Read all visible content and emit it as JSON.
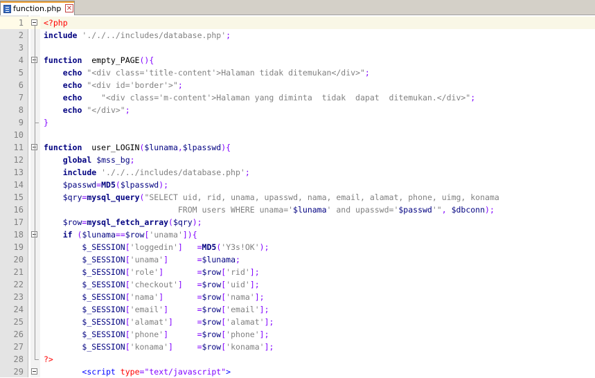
{
  "tab": {
    "filename": "function.php",
    "close_glyph": "✕",
    "icon": "php-file-icon"
  },
  "lines": [
    {
      "n": "1",
      "tokens": [
        [
          "t-php",
          "<?php"
        ]
      ]
    },
    {
      "n": "2",
      "tokens": [
        [
          "t-kw",
          "include"
        ],
        [
          "t-plain",
          " "
        ],
        [
          "t-str",
          "'././../includes/database.php'"
        ],
        [
          "t-op",
          ";"
        ]
      ]
    },
    {
      "n": "3",
      "tokens": []
    },
    {
      "n": "4",
      "tokens": [
        [
          "t-kw",
          "function"
        ],
        [
          "t-plain",
          "  empty_PAGE"
        ],
        [
          "t-op",
          "(){"
        ]
      ]
    },
    {
      "n": "5",
      "tokens": [
        [
          "t-plain",
          "    "
        ],
        [
          "t-kw",
          "echo"
        ],
        [
          "t-plain",
          " "
        ],
        [
          "t-str",
          "\"<div class='title-content'>Halaman tidak ditemukan</div>\""
        ],
        [
          "t-op",
          ";"
        ]
      ]
    },
    {
      "n": "6",
      "tokens": [
        [
          "t-plain",
          "    "
        ],
        [
          "t-kw",
          "echo"
        ],
        [
          "t-plain",
          " "
        ],
        [
          "t-str",
          "\"<div id='border'>\""
        ],
        [
          "t-op",
          ";"
        ]
      ]
    },
    {
      "n": "7",
      "tokens": [
        [
          "t-plain",
          "    "
        ],
        [
          "t-kw",
          "echo"
        ],
        [
          "t-plain",
          "    "
        ],
        [
          "t-str",
          "\"<div class='m-content'>Halaman yang diminta  tidak  dapat  ditemukan.</div>\""
        ],
        [
          "t-op",
          ";"
        ]
      ]
    },
    {
      "n": "8",
      "tokens": [
        [
          "t-plain",
          "    "
        ],
        [
          "t-kw",
          "echo"
        ],
        [
          "t-plain",
          " "
        ],
        [
          "t-str",
          "\"</div>\""
        ],
        [
          "t-op",
          ";"
        ]
      ]
    },
    {
      "n": "9",
      "tokens": [
        [
          "t-op",
          "}"
        ]
      ]
    },
    {
      "n": "10",
      "tokens": []
    },
    {
      "n": "11",
      "tokens": [
        [
          "t-kw",
          "function"
        ],
        [
          "t-plain",
          "  user_LOGIN"
        ],
        [
          "t-op",
          "("
        ],
        [
          "t-var",
          "$lunama"
        ],
        [
          "t-op",
          ","
        ],
        [
          "t-var",
          "$lpasswd"
        ],
        [
          "t-op",
          "){"
        ]
      ]
    },
    {
      "n": "12",
      "tokens": [
        [
          "t-plain",
          "    "
        ],
        [
          "t-kw",
          "global"
        ],
        [
          "t-plain",
          " "
        ],
        [
          "t-var",
          "$mss_bg"
        ],
        [
          "t-op",
          ";"
        ]
      ]
    },
    {
      "n": "13",
      "tokens": [
        [
          "t-plain",
          "    "
        ],
        [
          "t-kw",
          "include"
        ],
        [
          "t-plain",
          " "
        ],
        [
          "t-str",
          "'././../includes/database.php'"
        ],
        [
          "t-op",
          ";"
        ]
      ]
    },
    {
      "n": "14",
      "tokens": [
        [
          "t-plain",
          "    "
        ],
        [
          "t-var",
          "$passwd"
        ],
        [
          "t-op",
          "="
        ],
        [
          "t-fn",
          "MD5"
        ],
        [
          "t-op",
          "("
        ],
        [
          "t-var",
          "$lpasswd"
        ],
        [
          "t-op",
          ");"
        ]
      ]
    },
    {
      "n": "15",
      "tokens": [
        [
          "t-plain",
          "    "
        ],
        [
          "t-var",
          "$qry"
        ],
        [
          "t-op",
          "="
        ],
        [
          "t-fn",
          "mysql_query"
        ],
        [
          "t-op",
          "("
        ],
        [
          "t-str",
          "\"SELECT uid, rid, unama, upasswd, nama, email, alamat, phone, uimg, konama"
        ]
      ]
    },
    {
      "n": "16",
      "tokens": [
        [
          "t-plain",
          "                            "
        ],
        [
          "t-str",
          "FROM users WHERE unama='"
        ],
        [
          "t-var",
          "$lunama"
        ],
        [
          "t-str",
          "' and upasswd='"
        ],
        [
          "t-var",
          "$passwd"
        ],
        [
          "t-str",
          "'\""
        ],
        [
          "t-op",
          ", "
        ],
        [
          "t-var",
          "$dbconn"
        ],
        [
          "t-op",
          ");"
        ]
      ]
    },
    {
      "n": "17",
      "tokens": [
        [
          "t-plain",
          "    "
        ],
        [
          "t-var",
          "$row"
        ],
        [
          "t-op",
          "="
        ],
        [
          "t-fn",
          "mysql_fetch_array"
        ],
        [
          "t-op",
          "("
        ],
        [
          "t-var",
          "$qry"
        ],
        [
          "t-op",
          ");"
        ]
      ]
    },
    {
      "n": "18",
      "tokens": [
        [
          "t-plain",
          "    "
        ],
        [
          "t-kw",
          "if"
        ],
        [
          "t-plain",
          " "
        ],
        [
          "t-op",
          "("
        ],
        [
          "t-var",
          "$lunama"
        ],
        [
          "t-op",
          "=="
        ],
        [
          "t-var",
          "$row"
        ],
        [
          "t-op",
          "["
        ],
        [
          "t-str",
          "'unama'"
        ],
        [
          "t-op",
          "]){"
        ]
      ]
    },
    {
      "n": "19",
      "tokens": [
        [
          "t-plain",
          "        "
        ],
        [
          "t-var",
          "$_SESSION"
        ],
        [
          "t-op",
          "["
        ],
        [
          "t-str",
          "'loggedin'"
        ],
        [
          "t-op",
          "]"
        ],
        [
          "t-plain",
          "   "
        ],
        [
          "t-op",
          "="
        ],
        [
          "t-fn",
          "MD5"
        ],
        [
          "t-op",
          "("
        ],
        [
          "t-str",
          "'Y3s!OK'"
        ],
        [
          "t-op",
          ");"
        ]
      ]
    },
    {
      "n": "20",
      "tokens": [
        [
          "t-plain",
          "        "
        ],
        [
          "t-var",
          "$_SESSION"
        ],
        [
          "t-op",
          "["
        ],
        [
          "t-str",
          "'unama'"
        ],
        [
          "t-op",
          "]"
        ],
        [
          "t-plain",
          "      "
        ],
        [
          "t-op",
          "="
        ],
        [
          "t-var",
          "$lunama"
        ],
        [
          "t-op",
          ";"
        ]
      ]
    },
    {
      "n": "21",
      "tokens": [
        [
          "t-plain",
          "        "
        ],
        [
          "t-var",
          "$_SESSION"
        ],
        [
          "t-op",
          "["
        ],
        [
          "t-str",
          "'role'"
        ],
        [
          "t-op",
          "]"
        ],
        [
          "t-plain",
          "       "
        ],
        [
          "t-op",
          "="
        ],
        [
          "t-var",
          "$row"
        ],
        [
          "t-op",
          "["
        ],
        [
          "t-str",
          "'rid'"
        ],
        [
          "t-op",
          "];"
        ]
      ]
    },
    {
      "n": "22",
      "tokens": [
        [
          "t-plain",
          "        "
        ],
        [
          "t-var",
          "$_SESSION"
        ],
        [
          "t-op",
          "["
        ],
        [
          "t-str",
          "'checkout'"
        ],
        [
          "t-op",
          "]"
        ],
        [
          "t-plain",
          "   "
        ],
        [
          "t-op",
          "="
        ],
        [
          "t-var",
          "$row"
        ],
        [
          "t-op",
          "["
        ],
        [
          "t-str",
          "'uid'"
        ],
        [
          "t-op",
          "];"
        ]
      ]
    },
    {
      "n": "23",
      "tokens": [
        [
          "t-plain",
          "        "
        ],
        [
          "t-var",
          "$_SESSION"
        ],
        [
          "t-op",
          "["
        ],
        [
          "t-str",
          "'nama'"
        ],
        [
          "t-op",
          "]"
        ],
        [
          "t-plain",
          "       "
        ],
        [
          "t-op",
          "="
        ],
        [
          "t-var",
          "$row"
        ],
        [
          "t-op",
          "["
        ],
        [
          "t-str",
          "'nama'"
        ],
        [
          "t-op",
          "];"
        ]
      ]
    },
    {
      "n": "24",
      "tokens": [
        [
          "t-plain",
          "        "
        ],
        [
          "t-var",
          "$_SESSION"
        ],
        [
          "t-op",
          "["
        ],
        [
          "t-str",
          "'email'"
        ],
        [
          "t-op",
          "]"
        ],
        [
          "t-plain",
          "      "
        ],
        [
          "t-op",
          "="
        ],
        [
          "t-var",
          "$row"
        ],
        [
          "t-op",
          "["
        ],
        [
          "t-str",
          "'email'"
        ],
        [
          "t-op",
          "];"
        ]
      ]
    },
    {
      "n": "25",
      "tokens": [
        [
          "t-plain",
          "        "
        ],
        [
          "t-var",
          "$_SESSION"
        ],
        [
          "t-op",
          "["
        ],
        [
          "t-str",
          "'alamat'"
        ],
        [
          "t-op",
          "]"
        ],
        [
          "t-plain",
          "     "
        ],
        [
          "t-op",
          "="
        ],
        [
          "t-var",
          "$row"
        ],
        [
          "t-op",
          "["
        ],
        [
          "t-str",
          "'alamat'"
        ],
        [
          "t-op",
          "];"
        ]
      ]
    },
    {
      "n": "26",
      "tokens": [
        [
          "t-plain",
          "        "
        ],
        [
          "t-var",
          "$_SESSION"
        ],
        [
          "t-op",
          "["
        ],
        [
          "t-str",
          "'phone'"
        ],
        [
          "t-op",
          "]"
        ],
        [
          "t-plain",
          "      "
        ],
        [
          "t-op",
          "="
        ],
        [
          "t-var",
          "$row"
        ],
        [
          "t-op",
          "["
        ],
        [
          "t-str",
          "'phone'"
        ],
        [
          "t-op",
          "];"
        ]
      ]
    },
    {
      "n": "27",
      "tokens": [
        [
          "t-plain",
          "        "
        ],
        [
          "t-var",
          "$_SESSION"
        ],
        [
          "t-op",
          "["
        ],
        [
          "t-str",
          "'konama'"
        ],
        [
          "t-op",
          "]"
        ],
        [
          "t-plain",
          "     "
        ],
        [
          "t-op",
          "="
        ],
        [
          "t-var",
          "$row"
        ],
        [
          "t-op",
          "["
        ],
        [
          "t-str",
          "'konama'"
        ],
        [
          "t-op",
          "];"
        ]
      ]
    },
    {
      "n": "28",
      "tokens": [
        [
          "t-php",
          "?>"
        ]
      ]
    },
    {
      "n": "29",
      "tokens": [
        [
          "t-plain",
          "        "
        ],
        [
          "t-tag",
          "<script"
        ],
        [
          "t-plain",
          " "
        ],
        [
          "t-attr",
          "type"
        ],
        [
          "t-op",
          "="
        ],
        [
          "t-attrval",
          "\"text/javascript\""
        ],
        [
          "t-tag",
          ">"
        ]
      ]
    }
  ],
  "colors": {
    "gutter": "#e4e4e4",
    "current_line": "#f9f7e6",
    "keyword": "#000080",
    "string": "#808080",
    "php_delim": "#ff0000"
  }
}
